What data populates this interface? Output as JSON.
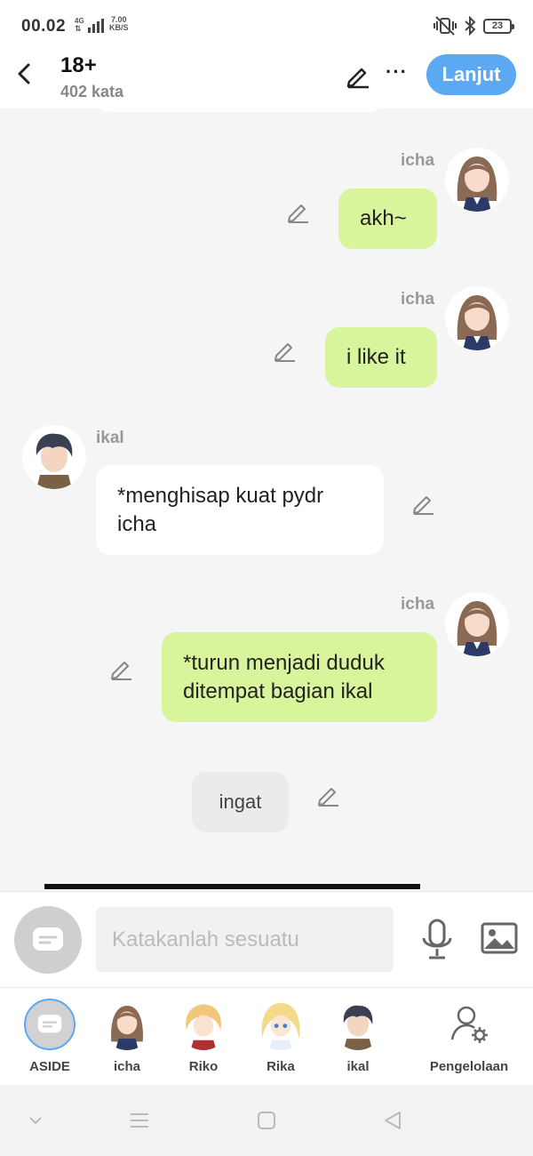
{
  "status_bar": {
    "time": "00.02",
    "network": "4G",
    "speed_value": "7.00",
    "speed_unit": "KB/S",
    "battery": "23"
  },
  "header": {
    "title": "18+",
    "word_count": "402 kata",
    "next_label": "Lanjut"
  },
  "messages": [
    {
      "sender": "icha",
      "text": "akh~",
      "side": "right"
    },
    {
      "sender": "icha",
      "text": "i like it",
      "side": "right"
    },
    {
      "sender": "ikal",
      "text_line1": "*menghisap kuat pydr",
      "text_line2": "icha",
      "side": "left"
    },
    {
      "sender": "icha",
      "text_line1": "*turun menjadi duduk",
      "text_line2": "ditempat bagian ikal",
      "side": "right"
    },
    {
      "sender": "",
      "text": "ingat",
      "side": "center"
    }
  ],
  "input": {
    "placeholder": "Katakanlah sesuatu"
  },
  "characters": [
    {
      "label": "ASIDE"
    },
    {
      "label": "icha"
    },
    {
      "label": "Riko"
    },
    {
      "label": "Rika"
    },
    {
      "label": "ikal"
    },
    {
      "label": "Pengelolaan"
    }
  ],
  "icons": {
    "back": "chevron-left-icon",
    "edit": "pencil-icon",
    "more": "more-dots-icon",
    "mic": "microphone-icon",
    "image": "image-icon",
    "manage": "user-settings-icon"
  },
  "colors": {
    "accent": "#5aa9f2",
    "my_bubble": "#d9f59b",
    "other_bubble": "#ffffff"
  }
}
